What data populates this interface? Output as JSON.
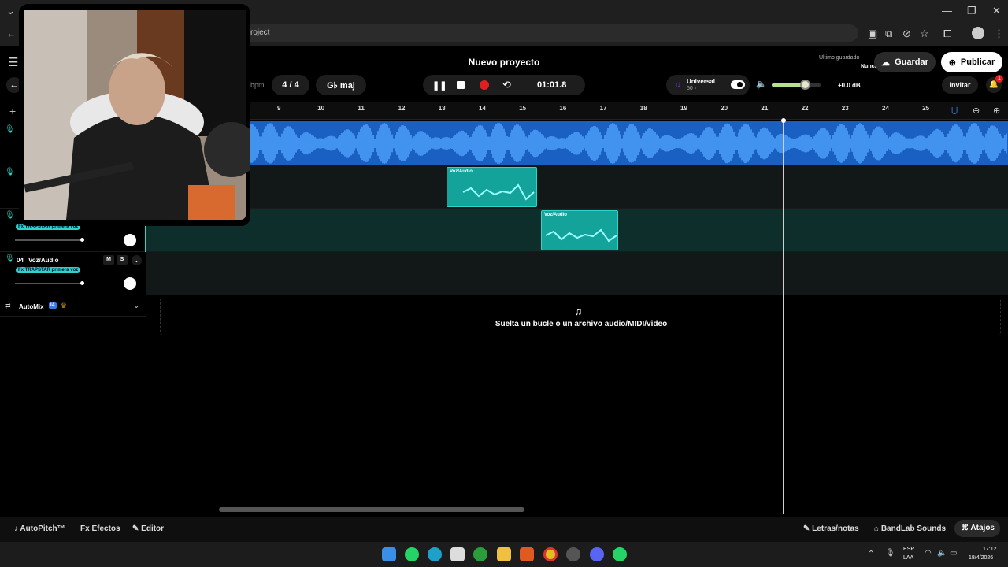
{
  "browser": {
    "url_fragment": "roject"
  },
  "header": {
    "project_title": "Nuevo proyecto",
    "bpm_label": "bpm",
    "time_signature": "4 / 4",
    "key": "G♭ maj",
    "time_display": "01:01.8",
    "preset_name": "Universal",
    "preset_sub": "50 ›",
    "gain": "+0.0 dB",
    "last_saved_label": "Último guardado",
    "last_saved_value": "Nunca",
    "save_label": "Guardar",
    "publish_label": "Publicar",
    "invite_label": "Invitar",
    "notif_count": "1"
  },
  "timeline": {
    "ticks": [
      "9",
      "10",
      "11",
      "12",
      "13",
      "14",
      "15",
      "16",
      "17",
      "18",
      "19",
      "20",
      "21",
      "22",
      "23",
      "24",
      "25"
    ]
  },
  "tracks": [
    {
      "number": "04",
      "name": "Voz/Audio",
      "fx": "Fx TRAPSTAR primera voz",
      "mute": "M",
      "solo": "S"
    }
  ],
  "track3_fx": "Fx TRAPSTAR primera voz",
  "automix": {
    "label": "AutoMix",
    "badge": "IA"
  },
  "clips": [
    {
      "label": "Voz/Audio"
    },
    {
      "label": "Voz/Audio"
    }
  ],
  "dropzone": {
    "text": "Suelta un bucle o un archivo audio/MIDI/video"
  },
  "bottom": {
    "autopitch": "AutoPitch™",
    "effects": "Efectos",
    "editor": "Editor",
    "lyrics": "Letras/notas",
    "sounds": "BandLab Sounds",
    "shortcuts": "Atajos"
  },
  "taskbar": {
    "lang1": "ESP",
    "lang2": "LAA",
    "time": "17:12",
    "date": "18/4/2026"
  },
  "colors": {
    "accent": "#2fd4c8",
    "waveform_blue": "#1e6fd6",
    "record_red": "#e02020"
  }
}
